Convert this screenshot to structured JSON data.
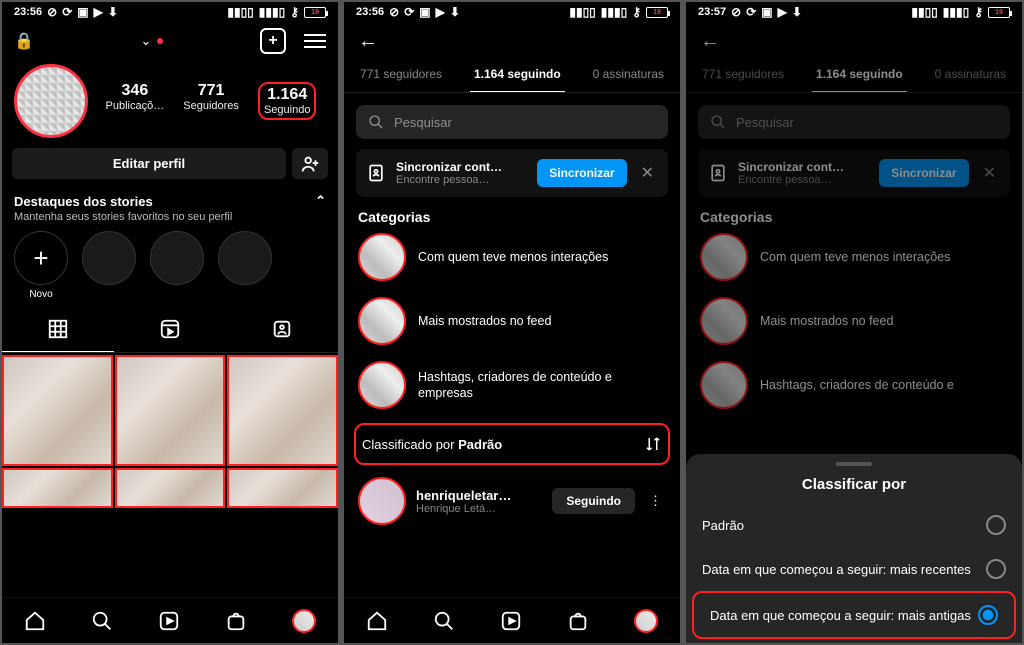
{
  "statusbar": {
    "time1": "23:56",
    "time3": "23:57",
    "battery": "19"
  },
  "s1": {
    "stats": {
      "posts_n": "346",
      "posts_l": "Publicaçõ…",
      "followers_n": "771",
      "followers_l": "Seguidores",
      "following_n": "1.164",
      "following_l": "Seguindo"
    },
    "edit": "Editar perfil",
    "hl_title": "Destaques dos stories",
    "hl_sub": "Mantenha seus stories favoritos no seu perfil",
    "hl_new": "Novo"
  },
  "tabs": {
    "followers": "771 seguidores",
    "following": "1.164 seguindo",
    "subs": "0 assinaturas"
  },
  "search_ph": "Pesquisar",
  "sync": {
    "title": "Sincronizar cont…",
    "sub": "Encontre pessoa…",
    "btn": "Sincronizar"
  },
  "cats_title": "Categorias",
  "cats": [
    "Com quem teve menos interações",
    "Mais mostrados no feed",
    "Hashtags, criadores de conteúdo e empresas"
  ],
  "sort_prefix": "Classificado por ",
  "sort_value": "Padrão",
  "user": {
    "username": "henriqueletar…",
    "fullname": "Henrique Letá…",
    "btn": "Seguindo"
  },
  "sheet": {
    "title": "Classificar por",
    "opt1": "Padrão",
    "opt2": "Data em que começou a seguir: mais recentes",
    "opt3": "Data em que começou a seguir: mais antigas"
  },
  "cats3_partial": "Hashtags, criadores de conteúdo e"
}
